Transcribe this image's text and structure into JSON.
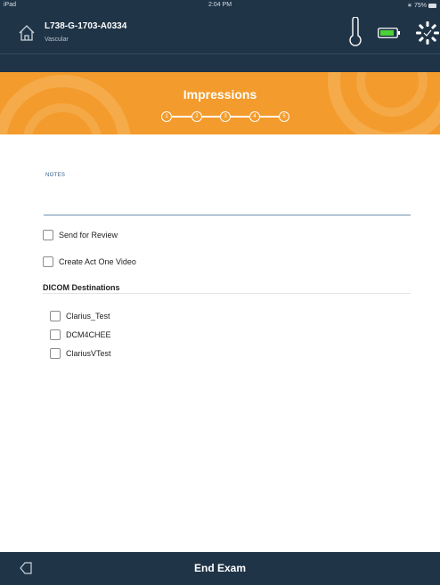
{
  "status_bar": {
    "carrier": "iPad",
    "time": "2:04 PM",
    "battery": "75%"
  },
  "header": {
    "exam_id": "L738-G-1703-A0334",
    "exam_type": "Vascular"
  },
  "banner": {
    "title": "Impressions",
    "steps": [
      "1",
      "2",
      "3",
      "4",
      "5"
    ]
  },
  "notes": {
    "label": "NOTES",
    "value": "",
    "placeholder": ""
  },
  "options": {
    "send_for_review": {
      "label": "Send for Review",
      "checked": false
    },
    "create_act_one_video": {
      "label": "Create Act One Video",
      "checked": false
    }
  },
  "dicom": {
    "title": "DICOM Destinations",
    "destinations": [
      {
        "label": "Clarius_Test",
        "checked": false
      },
      {
        "label": "DCM4CHEE",
        "checked": false
      },
      {
        "label": "ClariusVTest",
        "checked": false
      }
    ]
  },
  "footer": {
    "end_exam_label": "End Exam"
  },
  "colors": {
    "navy": "#1f3447",
    "orange": "#f39b2c",
    "battery_green": "#4cd137",
    "link_blue": "#2f5f8a"
  },
  "icons": [
    "home-icon",
    "thermometer-icon",
    "battery-icon",
    "spinner-icon",
    "back-icon"
  ]
}
